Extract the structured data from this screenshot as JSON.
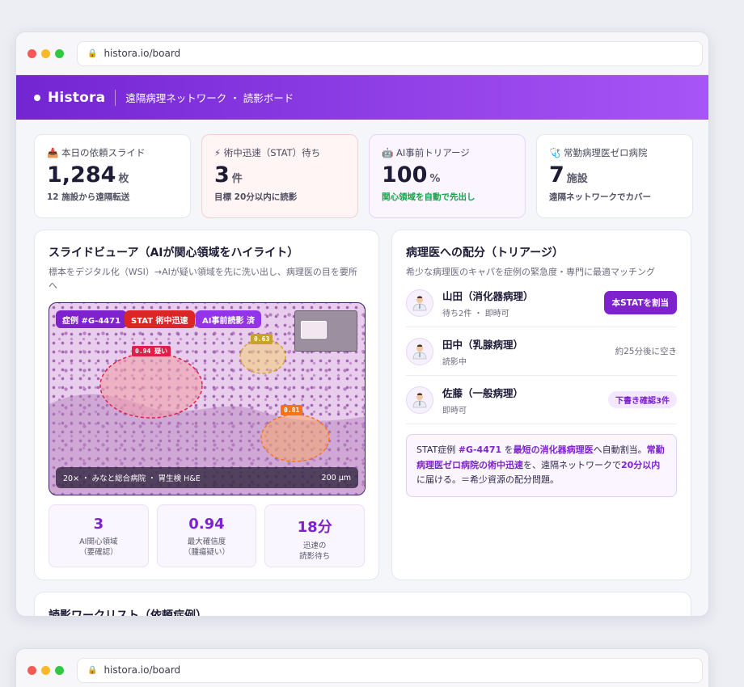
{
  "browser": {
    "url": "historа.io/board"
  },
  "app": {
    "brand": "Historа",
    "subtitle": "遠隔病理ネットワーク ・ 読影ボード"
  },
  "stats": [
    {
      "label": "📥 本日の依頼スライド",
      "value": "1,284",
      "unit": "枚",
      "note": "12 施設から遠隔転送"
    },
    {
      "label": "⚡ 術中迅速（STAT）待ち",
      "value": "3",
      "unit": "件",
      "note": "目標 20分以内に読影"
    },
    {
      "label": "🤖 AI事前トリアージ",
      "value": "100",
      "unit": "%",
      "note": "関心領域を自動で先出し"
    },
    {
      "label": "🩺 常勤病理医ゼロ病院",
      "value": "7",
      "unit": "施設",
      "note": "遠隔ネットワークでカバー"
    }
  ],
  "viewer": {
    "title": "スライドビューア（AIが関心領域をハイライト）",
    "subtitle": "標本をデジタル化（WSI）→AIが疑い領域を先に洗い出し、病理医の目を要所へ",
    "chips": {
      "case": "症例 #G-4471",
      "stat": "STAT 術中迅速",
      "ai": "AI事前読影 済"
    },
    "regions": [
      "0.94 疑い",
      "0.63",
      "0.81"
    ],
    "caption_left": "20× ・ みなと総合病院 ・ 胃生検 H&E",
    "caption_right": "200 µm",
    "metrics": [
      {
        "value": "3",
        "label": "AI関心領域\n（要確認）"
      },
      {
        "value": "0.94",
        "label": "最大確信度\n（腫瘍疑い）"
      },
      {
        "value": "18分",
        "label": "迅速の\n読影待ち"
      }
    ]
  },
  "triage": {
    "title": "病理医への配分（トリアージ）",
    "subtitle": "希少な病理医のキャパを症例の緊急度・専門に最適マッチング",
    "doctors": [
      {
        "name": "山田（消化器病理）",
        "meta": "待ち2件 ・ 即時可",
        "action": "本STATを割当"
      },
      {
        "name": "田中（乳腺病理）",
        "meta": "読影中",
        "status": "約25分後に空き"
      },
      {
        "name": "佐藤（一般病理）",
        "meta": "即時可",
        "pill": "下書き確認3件"
      }
    ],
    "note": {
      "p1": "STAT症例 ",
      "case": "#G-4471",
      "p2": " を",
      "b1": "最短の消化器病理医",
      "p3": "へ自動割当。",
      "b2": "常勤病理医ゼロ病院の術中迅速",
      "p4": "を、遠隔ネットワークで",
      "b3": "20分以内",
      "p5": "に届ける。＝希少資源の配分問題。"
    }
  },
  "worklist": {
    "title": "読影ワークリスト（依頼症例）"
  },
  "colors": {
    "accent": "#7e22ce",
    "header_start": "#7325d2",
    "header_end": "#a855f7",
    "stat_red": "#dc2626",
    "region_yellow": "#c9a227",
    "region_orange": "#f97316"
  }
}
